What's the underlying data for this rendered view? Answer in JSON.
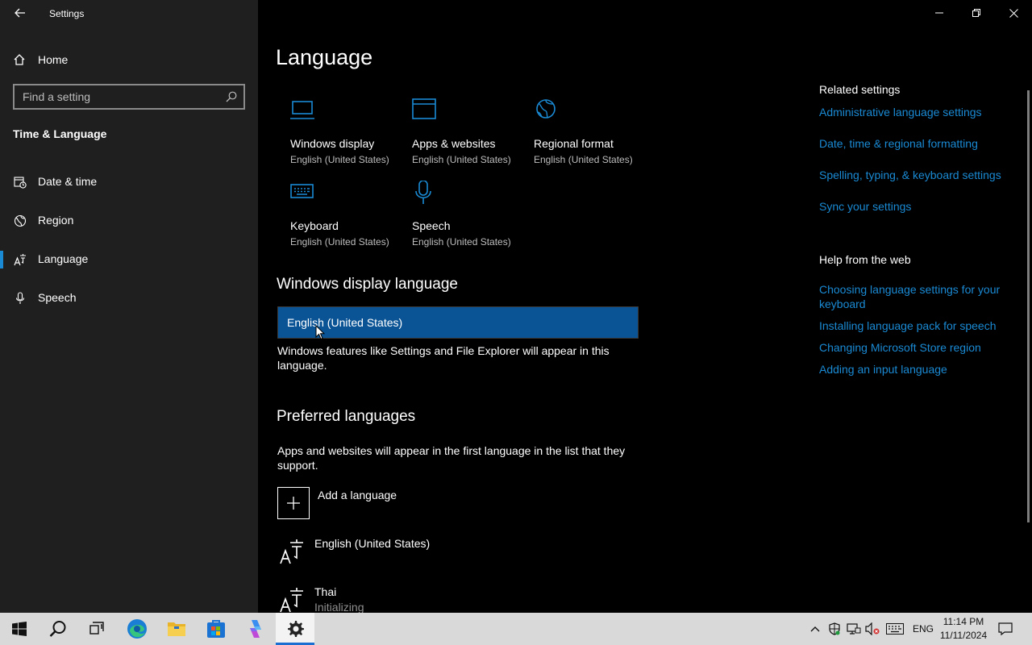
{
  "window": {
    "title": "Settings"
  },
  "sidebar": {
    "home_label": "Home",
    "search_placeholder": "Find a setting",
    "section_title": "Time & Language",
    "items": [
      {
        "label": "Date & time",
        "icon": "calendar-clock-icon",
        "active": false
      },
      {
        "label": "Region",
        "icon": "globe-icon",
        "active": false
      },
      {
        "label": "Language",
        "icon": "language-icon",
        "active": true
      },
      {
        "label": "Speech",
        "icon": "microphone-icon",
        "active": false
      }
    ]
  },
  "main": {
    "title": "Language",
    "tiles": [
      {
        "name": "Windows display",
        "sub": "English (United States)",
        "icon": "laptop-icon"
      },
      {
        "name": "Apps & websites",
        "sub": "English (United States)",
        "icon": "browser-window-icon"
      },
      {
        "name": "Regional format",
        "sub": "English (United States)",
        "icon": "globe-icon"
      },
      {
        "name": "Keyboard",
        "sub": "English (United States)",
        "icon": "keyboard-icon"
      },
      {
        "name": "Speech",
        "sub": "English (United States)",
        "icon": "microphone-icon"
      }
    ],
    "display_language": {
      "heading": "Windows display language",
      "selected": "English (United States)",
      "description": "Windows features like Settings and File Explorer will appear in this language."
    },
    "preferred": {
      "heading": "Preferred languages",
      "description": "Apps and websites will appear in the first language in the list that they support.",
      "add_label": "Add a language",
      "languages": [
        {
          "name": "English (United States)",
          "status": ""
        },
        {
          "name": "Thai",
          "status": "Initializing"
        }
      ]
    }
  },
  "related": {
    "heading": "Related settings",
    "links": [
      "Administrative language settings",
      "Date, time & regional formatting",
      "Spelling, typing, & keyboard settings",
      "Sync your settings"
    ],
    "help_heading": "Help from the web",
    "help_links": [
      "Choosing language settings for your keyboard",
      "Installing language pack for speech",
      "Changing Microsoft Store region",
      "Adding an input language"
    ]
  },
  "taskbar": {
    "apps": [
      "start-icon",
      "search-icon",
      "task-view-icon",
      "edge-icon",
      "file-explorer-icon",
      "store-icon",
      "copilot-icon",
      "settings-icon"
    ],
    "active_app": "settings-icon",
    "input_language": "ENG",
    "time": "11:14 PM",
    "date": "11/11/2024"
  },
  "colors": {
    "accent": "#1a8ad4",
    "selection": "#0a5394",
    "sidebar_bg": "#1f1f1f",
    "content_bg": "#000000",
    "taskbar_bg": "#d9d9d9"
  }
}
